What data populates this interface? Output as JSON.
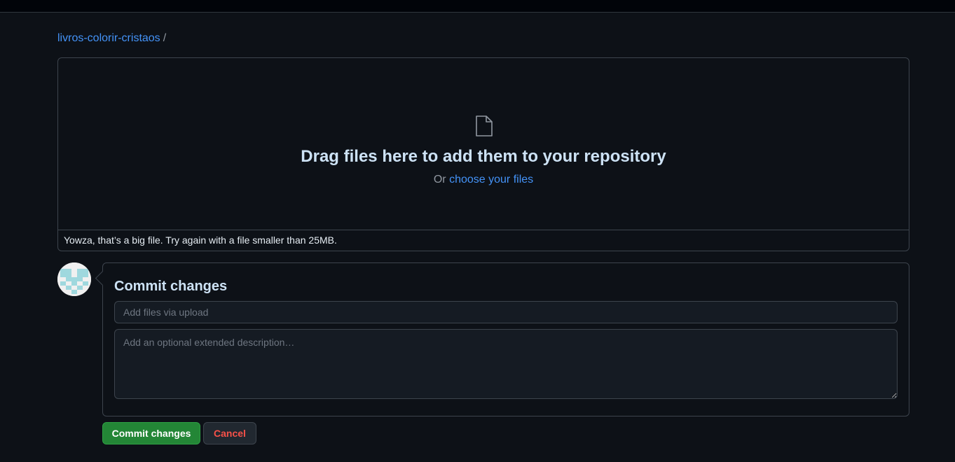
{
  "breadcrumb": {
    "repo": "livros-colorir-cristaos",
    "separator": "/"
  },
  "dropzone": {
    "icon": "file-icon",
    "title": "Drag files here to add them to your repository",
    "or_text": "Or",
    "choose_link": "choose your files",
    "error": "Yowza, that’s a big file. Try again with a file smaller than 25MB."
  },
  "commit": {
    "title": "Commit changes",
    "summary_placeholder": "Add files via upload",
    "description_placeholder": "Add an optional extended description…",
    "commit_button": "Commit changes",
    "cancel_button": "Cancel"
  },
  "colors": {
    "accent_link": "#4493f8",
    "commit_green": "#238636",
    "danger": "#f85149",
    "background": "#0d1117"
  }
}
